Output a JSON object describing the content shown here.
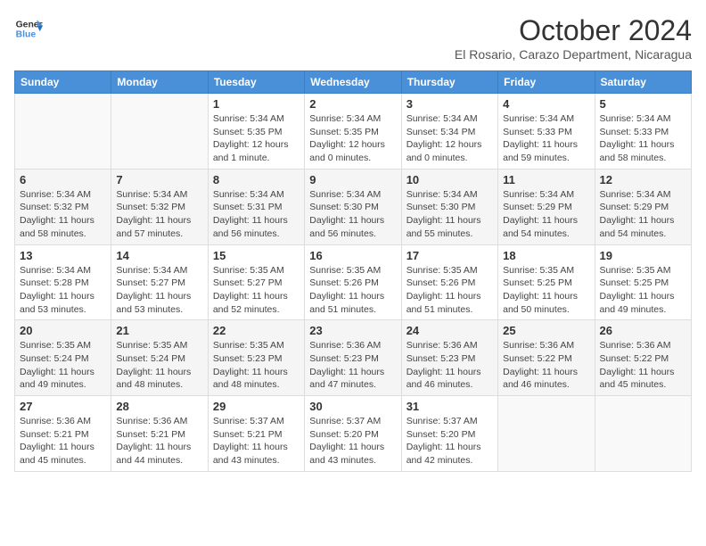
{
  "header": {
    "logo_line1": "General",
    "logo_line2": "Blue",
    "month_title": "October 2024",
    "subtitle": "El Rosario, Carazo Department, Nicaragua"
  },
  "weekdays": [
    "Sunday",
    "Monday",
    "Tuesday",
    "Wednesday",
    "Thursday",
    "Friday",
    "Saturday"
  ],
  "weeks": [
    [
      {
        "day": "",
        "info": ""
      },
      {
        "day": "",
        "info": ""
      },
      {
        "day": "1",
        "info": "Sunrise: 5:34 AM\nSunset: 5:35 PM\nDaylight: 12 hours\nand 1 minute."
      },
      {
        "day": "2",
        "info": "Sunrise: 5:34 AM\nSunset: 5:35 PM\nDaylight: 12 hours\nand 0 minutes."
      },
      {
        "day": "3",
        "info": "Sunrise: 5:34 AM\nSunset: 5:34 PM\nDaylight: 12 hours\nand 0 minutes."
      },
      {
        "day": "4",
        "info": "Sunrise: 5:34 AM\nSunset: 5:33 PM\nDaylight: 11 hours\nand 59 minutes."
      },
      {
        "day": "5",
        "info": "Sunrise: 5:34 AM\nSunset: 5:33 PM\nDaylight: 11 hours\nand 58 minutes."
      }
    ],
    [
      {
        "day": "6",
        "info": "Sunrise: 5:34 AM\nSunset: 5:32 PM\nDaylight: 11 hours\nand 58 minutes."
      },
      {
        "day": "7",
        "info": "Sunrise: 5:34 AM\nSunset: 5:32 PM\nDaylight: 11 hours\nand 57 minutes."
      },
      {
        "day": "8",
        "info": "Sunrise: 5:34 AM\nSunset: 5:31 PM\nDaylight: 11 hours\nand 56 minutes."
      },
      {
        "day": "9",
        "info": "Sunrise: 5:34 AM\nSunset: 5:30 PM\nDaylight: 11 hours\nand 56 minutes."
      },
      {
        "day": "10",
        "info": "Sunrise: 5:34 AM\nSunset: 5:30 PM\nDaylight: 11 hours\nand 55 minutes."
      },
      {
        "day": "11",
        "info": "Sunrise: 5:34 AM\nSunset: 5:29 PM\nDaylight: 11 hours\nand 54 minutes."
      },
      {
        "day": "12",
        "info": "Sunrise: 5:34 AM\nSunset: 5:29 PM\nDaylight: 11 hours\nand 54 minutes."
      }
    ],
    [
      {
        "day": "13",
        "info": "Sunrise: 5:34 AM\nSunset: 5:28 PM\nDaylight: 11 hours\nand 53 minutes."
      },
      {
        "day": "14",
        "info": "Sunrise: 5:34 AM\nSunset: 5:27 PM\nDaylight: 11 hours\nand 53 minutes."
      },
      {
        "day": "15",
        "info": "Sunrise: 5:35 AM\nSunset: 5:27 PM\nDaylight: 11 hours\nand 52 minutes."
      },
      {
        "day": "16",
        "info": "Sunrise: 5:35 AM\nSunset: 5:26 PM\nDaylight: 11 hours\nand 51 minutes."
      },
      {
        "day": "17",
        "info": "Sunrise: 5:35 AM\nSunset: 5:26 PM\nDaylight: 11 hours\nand 51 minutes."
      },
      {
        "day": "18",
        "info": "Sunrise: 5:35 AM\nSunset: 5:25 PM\nDaylight: 11 hours\nand 50 minutes."
      },
      {
        "day": "19",
        "info": "Sunrise: 5:35 AM\nSunset: 5:25 PM\nDaylight: 11 hours\nand 49 minutes."
      }
    ],
    [
      {
        "day": "20",
        "info": "Sunrise: 5:35 AM\nSunset: 5:24 PM\nDaylight: 11 hours\nand 49 minutes."
      },
      {
        "day": "21",
        "info": "Sunrise: 5:35 AM\nSunset: 5:24 PM\nDaylight: 11 hours\nand 48 minutes."
      },
      {
        "day": "22",
        "info": "Sunrise: 5:35 AM\nSunset: 5:23 PM\nDaylight: 11 hours\nand 48 minutes."
      },
      {
        "day": "23",
        "info": "Sunrise: 5:36 AM\nSunset: 5:23 PM\nDaylight: 11 hours\nand 47 minutes."
      },
      {
        "day": "24",
        "info": "Sunrise: 5:36 AM\nSunset: 5:23 PM\nDaylight: 11 hours\nand 46 minutes."
      },
      {
        "day": "25",
        "info": "Sunrise: 5:36 AM\nSunset: 5:22 PM\nDaylight: 11 hours\nand 46 minutes."
      },
      {
        "day": "26",
        "info": "Sunrise: 5:36 AM\nSunset: 5:22 PM\nDaylight: 11 hours\nand 45 minutes."
      }
    ],
    [
      {
        "day": "27",
        "info": "Sunrise: 5:36 AM\nSunset: 5:21 PM\nDaylight: 11 hours\nand 45 minutes."
      },
      {
        "day": "28",
        "info": "Sunrise: 5:36 AM\nSunset: 5:21 PM\nDaylight: 11 hours\nand 44 minutes."
      },
      {
        "day": "29",
        "info": "Sunrise: 5:37 AM\nSunset: 5:21 PM\nDaylight: 11 hours\nand 43 minutes."
      },
      {
        "day": "30",
        "info": "Sunrise: 5:37 AM\nSunset: 5:20 PM\nDaylight: 11 hours\nand 43 minutes."
      },
      {
        "day": "31",
        "info": "Sunrise: 5:37 AM\nSunset: 5:20 PM\nDaylight: 11 hours\nand 42 minutes."
      },
      {
        "day": "",
        "info": ""
      },
      {
        "day": "",
        "info": ""
      }
    ]
  ]
}
